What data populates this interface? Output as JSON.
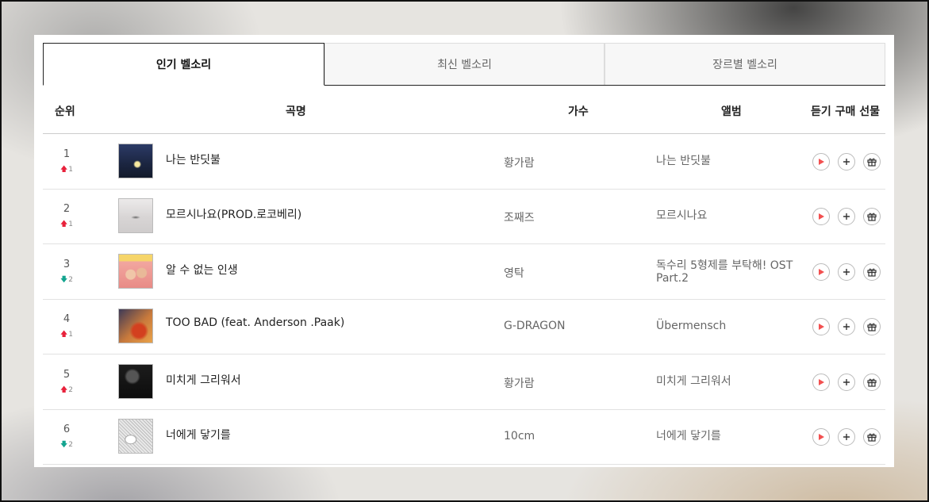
{
  "tabs": [
    {
      "label": "인기 벨소리",
      "active": true
    },
    {
      "label": "최신 벨소리",
      "active": false
    },
    {
      "label": "장르별 벨소리",
      "active": false
    }
  ],
  "columns": {
    "rank": "순위",
    "title": "곡명",
    "artist": "가수",
    "album": "앨범",
    "actions": "듣기 구매 선물"
  },
  "rows": [
    {
      "rank": "1",
      "dir": "up",
      "arrow": "🡅",
      "change": "1",
      "title": "나는 반딧불",
      "artist": "황가람",
      "album": "나는 반딧불"
    },
    {
      "rank": "2",
      "dir": "up",
      "arrow": "🡅",
      "change": "1",
      "title": "모르시나요(PROD.로코베리)",
      "artist": "조째즈",
      "album": "모르시나요"
    },
    {
      "rank": "3",
      "dir": "down",
      "arrow": "🡇",
      "change": "2",
      "title": "알 수 없는 인생",
      "artist": "영탁",
      "album": "독수리 5형제를 부탁해! OST Part.2"
    },
    {
      "rank": "4",
      "dir": "up",
      "arrow": "🡅",
      "change": "1",
      "title": "TOO BAD (feat. Anderson .Paak)",
      "artist": "G-DRAGON",
      "album": "Übermensch"
    },
    {
      "rank": "5",
      "dir": "up",
      "arrow": "🡅",
      "change": "2",
      "title": "미치게 그리워서",
      "artist": "황가람",
      "album": "미치게 그리워서"
    },
    {
      "rank": "6",
      "dir": "down",
      "arrow": "🡇",
      "change": "2",
      "title": "너에게 닿기를",
      "artist": "10cm",
      "album": "너에게 닿기를"
    }
  ],
  "colors": {
    "up": "#e8213b",
    "down": "#13a48f",
    "play": "#f25050"
  },
  "icons": {
    "play": "play-icon",
    "add": "plus-icon",
    "gift": "gift-icon"
  }
}
